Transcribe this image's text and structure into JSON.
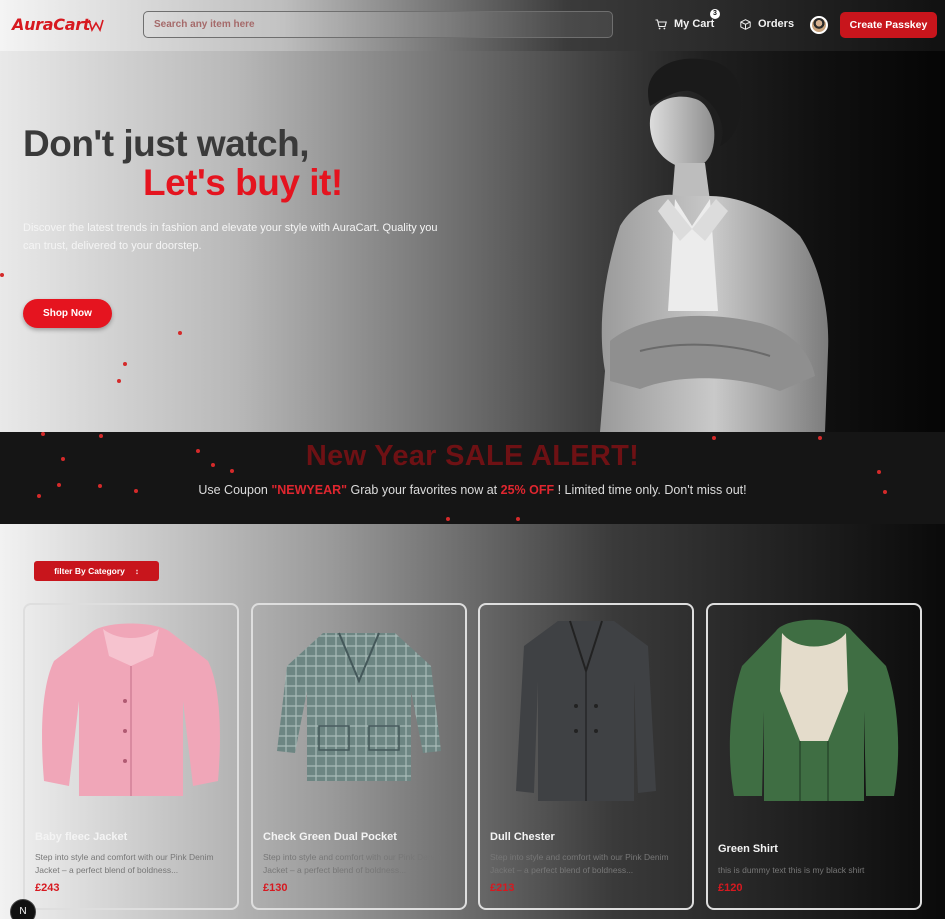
{
  "header": {
    "logo": "AuraCart",
    "search_placeholder": "Search any item here",
    "cart_label": "My Cart",
    "cart_count": "3",
    "orders_label": "Orders",
    "passkey_label": "Create Passkey"
  },
  "hero": {
    "line1": "Don't just watch,",
    "line2": "Let's buy it!",
    "description": "Discover the latest trends in fashion and elevate your style with AuraCart. Quality you can trust, delivered to your doorstep.",
    "cta": "Shop Now"
  },
  "sale": {
    "title": "New Year SALE ALERT!",
    "text_before": "Use Coupon ",
    "coupon": "\"NEWYEAR\"",
    "text_mid": " Grab your favorites now at ",
    "discount": "25% OFF",
    "text_after": " ! Limited time only. Don't miss out!"
  },
  "filter": {
    "label": "filter By Category",
    "icon": "chevron-updown-icon"
  },
  "products": [
    {
      "name": "Baby fleec Jacket",
      "description": "Step into style and comfort with our Pink Denim Jacket – a perfect blend of boldness...",
      "price": "£243"
    },
    {
      "name": "Check Green Dual Pocket",
      "description": "Step into style and comfort with our Pink Denim Jacket – a perfect blend of boldness...",
      "price": "£130"
    },
    {
      "name": "Dull Chester",
      "description": "Step into style and comfort with our Pink Denim Jacket – a perfect blend of boldness...",
      "price": "£213"
    },
    {
      "name": "Green Shirt",
      "description": "this is dummy text this is my black shirt",
      "price": "£120"
    }
  ],
  "dev_indicator": "N",
  "colors": {
    "accent": "#e5141f",
    "button": "#c8151c",
    "sale_title": "#6e1114"
  }
}
